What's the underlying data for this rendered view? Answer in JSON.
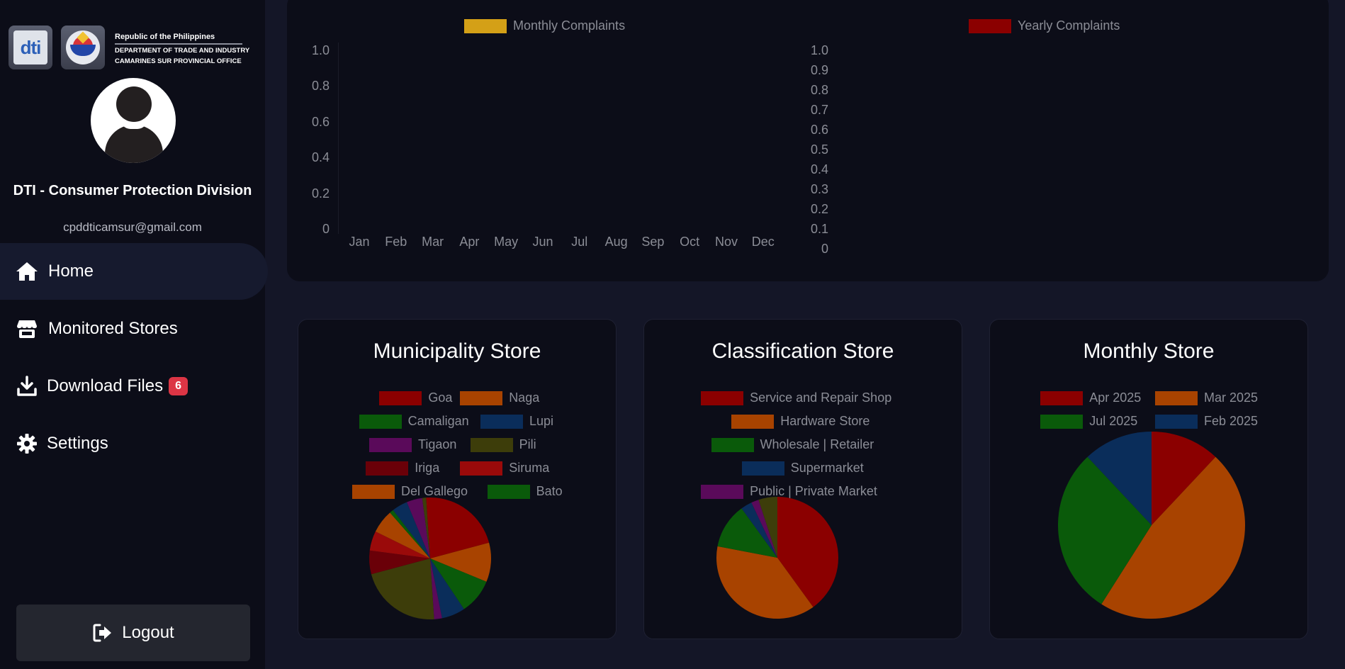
{
  "header": {
    "org_line1": "Republic of the Philippines",
    "org_line2": "DEPARTMENT OF TRADE AND INDUSTRY",
    "org_line3": "CAMARINES SUR PROVINCIAL OFFICE",
    "logo1_text": "dti"
  },
  "profile": {
    "name": "DTI - Consumer Protection Division",
    "email": "cpddticamsur@gmail.com"
  },
  "nav": {
    "home": "Home",
    "monitored_stores": "Monitored Stores",
    "download_files": "Download Files",
    "download_badge": "6",
    "settings": "Settings",
    "logout": "Logout"
  },
  "icons": {
    "home": "home-icon",
    "store": "store-icon",
    "download": "download-icon",
    "settings": "gear-icon",
    "logout": "logout-icon"
  },
  "colors": {
    "page_bg": "#141627",
    "panel_bg": "#0c0d18",
    "badge_bg": "#dc3545",
    "monthly_complaints": "#d4a017",
    "yearly_complaints": "#8b0000"
  },
  "chart_data": [
    {
      "type": "bar",
      "series": [
        {
          "name": "Monthly Complaints",
          "values": [
            0,
            0,
            0,
            0,
            0,
            0,
            0,
            0,
            0,
            0,
            0,
            0
          ]
        }
      ],
      "categories": [
        "Jan",
        "Feb",
        "Mar",
        "Apr",
        "May",
        "Jun",
        "Jul",
        "Aug",
        "Sep",
        "Oct",
        "Nov",
        "Dec"
      ],
      "yticks": [
        "0",
        "0.2",
        "0.4",
        "0.6",
        "0.8",
        "1.0"
      ],
      "ylim": [
        0,
        1
      ],
      "legend": "top"
    },
    {
      "type": "bar",
      "series": [
        {
          "name": "Yearly Complaints",
          "values": []
        }
      ],
      "categories": [],
      "yticks": [
        "0",
        "0.1",
        "0.2",
        "0.3",
        "0.4",
        "0.5",
        "0.6",
        "0.7",
        "0.8",
        "0.9",
        "1.0"
      ],
      "ylim": [
        0,
        1
      ],
      "legend": "top"
    },
    {
      "type": "pie",
      "title": "Municipality Store",
      "legend": "top",
      "slices": [
        {
          "label": "Goa",
          "value": 20,
          "color": "#8b0000"
        },
        {
          "label": "Naga",
          "value": 10,
          "color": "#a84300"
        },
        {
          "label": "Camaligan",
          "value": 9,
          "color": "#0a5a0a"
        },
        {
          "label": "Lupi",
          "value": 6,
          "color": "#0a2d5a"
        },
        {
          "label": "Tigaon",
          "value": 2,
          "color": "#5a0a5a"
        },
        {
          "label": "Pili",
          "value": 21,
          "color": "#3d3d0a"
        },
        {
          "label": "Iriga",
          "value": 6,
          "color": "#6a0008"
        },
        {
          "label": "Siruma",
          "value": 5,
          "color": "#9a0a0a"
        },
        {
          "label": "Del Gallego",
          "value": 6,
          "color": "#a84300"
        },
        {
          "label": "Bato",
          "value": 1,
          "color": "#0a5a0a"
        },
        {
          "label": "",
          "value": 4,
          "color": "#0a2d5a"
        },
        {
          "label": "",
          "value": 4,
          "color": "#5a0a5a"
        },
        {
          "label": "",
          "value": 1,
          "color": "#3d3d0a"
        },
        {
          "label": "",
          "value": 1,
          "color": "#8b0000"
        }
      ]
    },
    {
      "type": "pie",
      "title": "Classification Store",
      "legend": "top",
      "slices": [
        {
          "label": "Service and Repair Shop",
          "value": 40,
          "color": "#8b0000"
        },
        {
          "label": "Hardware Store",
          "value": 38,
          "color": "#a84300"
        },
        {
          "label": "Wholesale | Retailer",
          "value": 12,
          "color": "#0a5a0a"
        },
        {
          "label": "Supermarket",
          "value": 3,
          "color": "#0a2d5a"
        },
        {
          "label": "Public | Private Market",
          "value": 2,
          "color": "#5a0a5a"
        },
        {
          "label": "",
          "value": 5,
          "color": "#3d3d0a"
        }
      ]
    },
    {
      "type": "pie",
      "title": "Monthly Store",
      "legend": "top",
      "slices": [
        {
          "label": "Apr 2025",
          "value": 12,
          "color": "#8b0000"
        },
        {
          "label": "Mar 2025",
          "value": 47,
          "color": "#a84300"
        },
        {
          "label": "Jul 2025",
          "value": 29,
          "color": "#0a5a0a"
        },
        {
          "label": "Feb 2025",
          "value": 12,
          "color": "#0a2d5a"
        }
      ]
    }
  ]
}
